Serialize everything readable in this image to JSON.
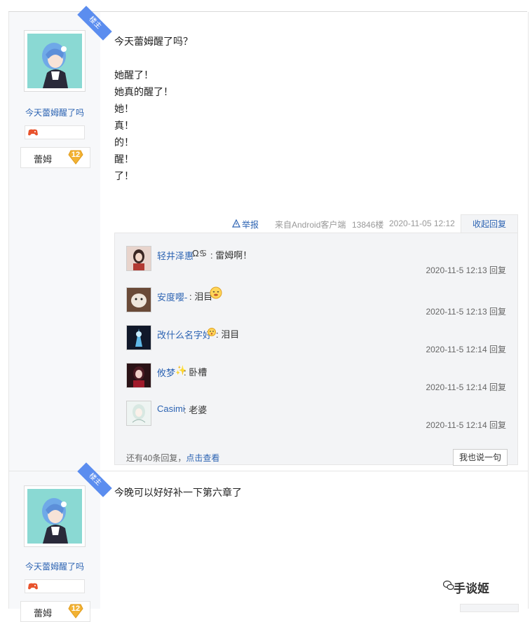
{
  "post1": {
    "ribbon": "楼主",
    "username": "今天蕾姆醒了吗",
    "badge_label": "蕾姆",
    "level": "12",
    "content_lines": [
      "今天蕾姆醒了吗？",
      "",
      "她醒了！",
      "她真的醒了！",
      "她！",
      "真！",
      "的！",
      "醒！",
      "了！"
    ],
    "tail": {
      "report": "举报",
      "source": "来自Android客户端",
      "floor": "13846楼",
      "date": "2020-11-05 12:12",
      "collapse": "收起回复"
    },
    "replies": [
      {
        "name": "轻井泽惠",
        "suffix": "Ω♋",
        "text": ": 雷姆啊！",
        "time": "2020-11-5 12:13",
        "action": "回复"
      },
      {
        "name": "安度嘤-",
        "suffix": "",
        "text": ": 泪目",
        "time": "2020-11-5 12:13",
        "action": "回复"
      },
      {
        "name": "改什么名字好",
        "suffix": "",
        "text": ": 泪目",
        "time": "2020-11-5 12:14",
        "action": "回复"
      },
      {
        "name": "攸梦",
        "suffix": "✨",
        "text": ": 卧槽",
        "time": "2020-11-5 12:14",
        "action": "回复"
      },
      {
        "name": "Casimi",
        "suffix": "",
        "text": ": 老婆",
        "time": "2020-11-5 12:14",
        "action": "回复"
      }
    ],
    "more_prefix": "还有40条回复，",
    "more_link": "点击查看",
    "say_button": "我也说一句"
  },
  "post2": {
    "ribbon": "楼主",
    "username": "今天蕾姆醒了吗",
    "badge_label": "蕾姆",
    "level": "12",
    "content": "今晚可以好好补一下第六章了"
  },
  "watermark": "手谈姬",
  "colors": {
    "link": "#2d64b3",
    "ribbon": "#5b8def",
    "avatar_bg": "#8ad9d3",
    "level_badge": "#f2b233"
  }
}
